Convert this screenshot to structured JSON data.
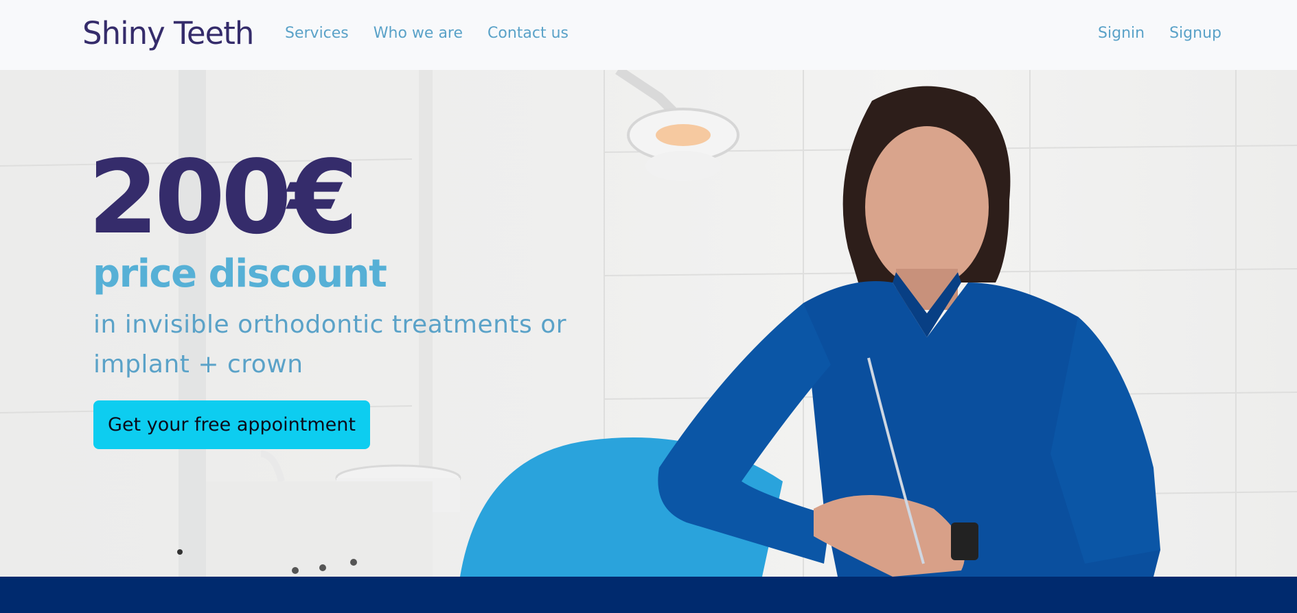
{
  "header": {
    "logo": "Shiny Teeth",
    "nav_left": [
      "Services",
      "Who we are",
      "Contact us"
    ],
    "nav_right": [
      "Signin",
      "Signup"
    ]
  },
  "hero": {
    "amount": "200€",
    "discount": "price discount",
    "description": "in invisible orthodontic treatments or implant + crown",
    "cta": "Get your free appointment"
  },
  "colors": {
    "brand_dark": "#352c6b",
    "brand_light": "#56b0d6",
    "nav_link": "#5aa2c8",
    "cta_bg": "#0dcdf0",
    "footer_band": "#002a6e",
    "uniform_blue": "#0a4f9e",
    "chair_blue": "#2aa3dc"
  }
}
